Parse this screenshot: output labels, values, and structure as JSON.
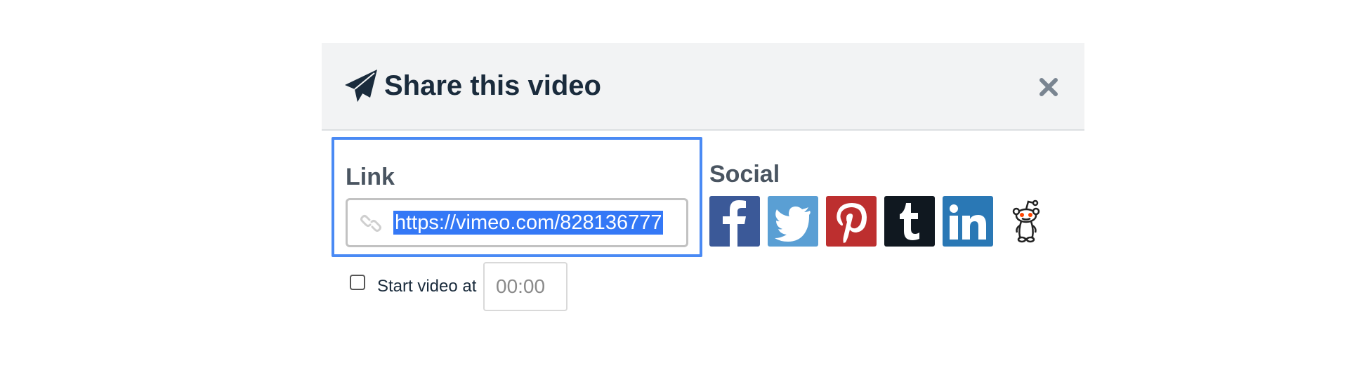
{
  "modal": {
    "title": "Share this video",
    "close_icon": "close-icon",
    "header_icon": "paper-plane-icon"
  },
  "link": {
    "label": "Link",
    "url": "https://vimeo.com/828136777",
    "icon": "link-chain-icon",
    "selection_color": "#3478f6",
    "focus_color": "#4a8af4"
  },
  "social": {
    "label": "Social",
    "buttons": [
      {
        "name": "facebook",
        "icon": "facebook-icon",
        "color": "#3b5998"
      },
      {
        "name": "twitter",
        "icon": "twitter-icon",
        "color": "#5a9fd4"
      },
      {
        "name": "pinterest",
        "icon": "pinterest-icon",
        "color": "#bd2f2f"
      },
      {
        "name": "tumblr",
        "icon": "tumblr-icon",
        "color": "#101820"
      },
      {
        "name": "linkedin",
        "icon": "linkedin-icon",
        "color": "#2a78b5"
      },
      {
        "name": "reddit",
        "icon": "reddit-icon",
        "color": "#ff4500"
      }
    ]
  },
  "start_video": {
    "label": "Start video at",
    "checked": false,
    "time_placeholder": "00:00"
  }
}
